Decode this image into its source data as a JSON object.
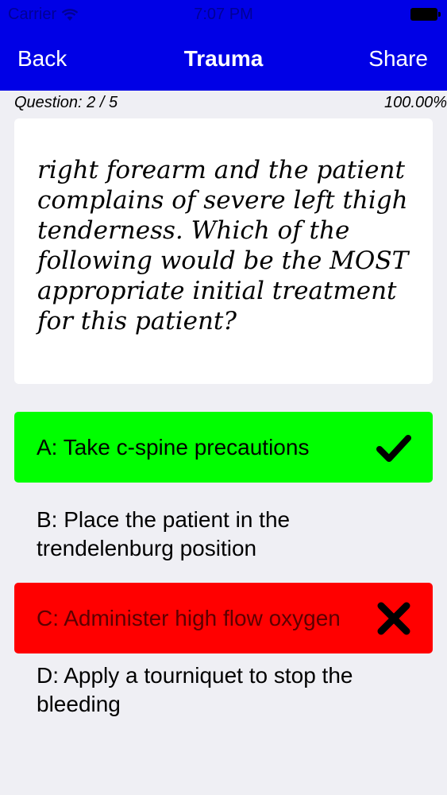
{
  "status_bar": {
    "carrier": "Carrier",
    "time": "7:07 PM"
  },
  "nav": {
    "back_label": "Back",
    "title": "Trauma",
    "share_label": "Share"
  },
  "quiz": {
    "question_counter": "Question: 2 / 5",
    "progress_percent": "100.00%",
    "question_text": "right forearm and the patient complains of severe left thigh tenderness. Which of the following would be the MOST appropriate initial treatment for this patient?"
  },
  "answers": [
    {
      "label": "A: Take c-spine precautions",
      "state": "correct",
      "color": "#00ff00",
      "icon": "checkmark-icon"
    },
    {
      "label": "B: Place the patient in the trendelenburg position",
      "state": "none"
    },
    {
      "label": "C: Administer high flow oxygen",
      "state": "incorrect",
      "color": "#ff0000",
      "icon": "cross-icon"
    },
    {
      "label": "D: Apply a tourniquet to stop the bleeding",
      "state": "none"
    }
  ],
  "colors": {
    "accent": "#0000e6",
    "background": "#efeff4",
    "correct": "#00ff00",
    "incorrect": "#ff0000"
  }
}
